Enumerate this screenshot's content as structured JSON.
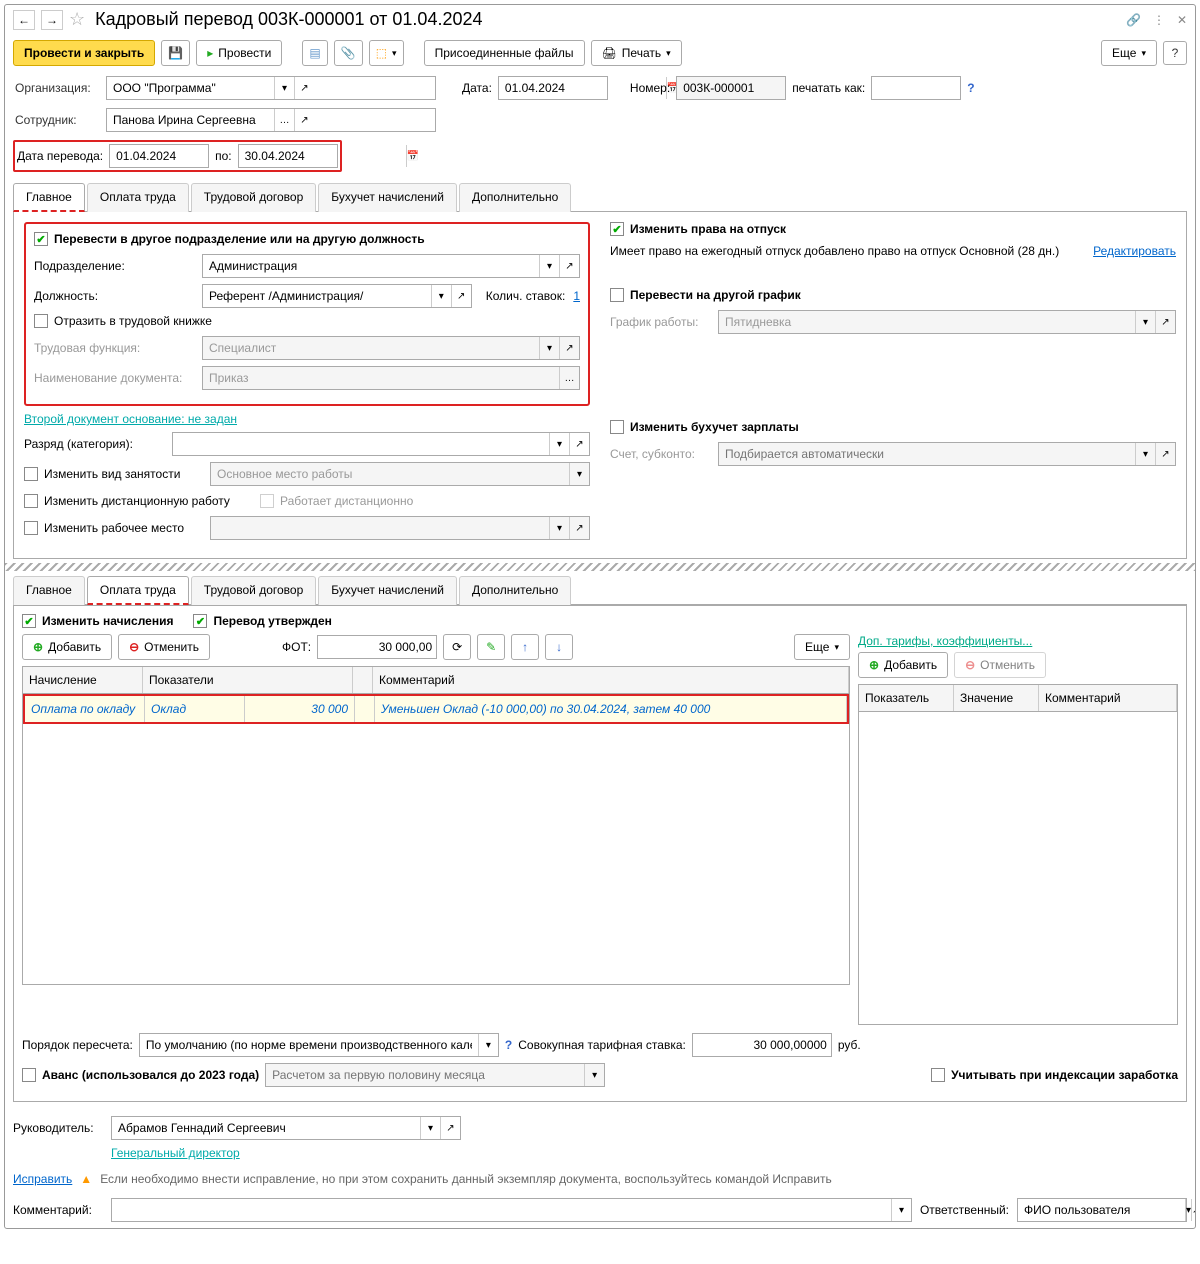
{
  "title": "Кадровый перевод 003К-000001 от 01.04.2024",
  "toolbar": {
    "post_close": "Провести и закрыть",
    "post": "Провести",
    "attached": "Присоединенные файлы",
    "print": "Печать",
    "more": "Еще"
  },
  "header": {
    "org_label": "Организация:",
    "org_value": "ООО \"Программа\"",
    "date_label": "Дата:",
    "date_value": "01.04.2024",
    "num_label": "Номер:",
    "num_value": "003К-000001",
    "print_as_label": "печатать как:",
    "emp_label": "Сотрудник:",
    "emp_value": "Панова Ирина Сергеевна",
    "transfer_date_label": "Дата перевода:",
    "transfer_from": "01.04.2024",
    "to_label": "по:",
    "transfer_to": "30.04.2024"
  },
  "tabs1": [
    "Главное",
    "Оплата труда",
    "Трудовой договор",
    "Бухучет начислений",
    "Дополнительно"
  ],
  "main": {
    "transfer_chk": "Перевести в другое подразделение или на другую должность",
    "subdiv_label": "Подразделение:",
    "subdiv_value": "Администрация",
    "pos_label": "Должность:",
    "pos_value": "Референт /Администрация/",
    "rates_label": "Колич. ставок:",
    "rates_value": "1",
    "labor_book": "Отразить в трудовой книжке",
    "func_label": "Трудовая функция:",
    "func_value": "Специалист",
    "docname_label": "Наименование документа:",
    "docname_value": "Приказ",
    "second_doc": "Второй документ основание: не задан",
    "grade_label": "Разряд (категория):",
    "change_emp": "Изменить вид занятости",
    "emp_type": "Основное место работы",
    "change_remote": "Изменить дистанционную работу",
    "remote_val": "Работает дистанционно",
    "change_workplace": "Изменить рабочее место",
    "vac_chk": "Изменить права на отпуск",
    "vac_text": "Имеет право на ежегодный отпуск добавлено право на отпуск Основной (28 дн.)",
    "edit_link": "Редактировать",
    "sched_chk": "Перевести на другой график",
    "sched_label": "График работы:",
    "sched_value": "Пятидневка",
    "change_acc": "Изменить бухучет зарплаты",
    "acc_label": "Счет, субконто:",
    "acc_ph": "Подбирается автоматически"
  },
  "pay": {
    "change_accruals": "Изменить начисления",
    "transfer_approved": "Перевод утвержден",
    "add": "Добавить",
    "cancel": "Отменить",
    "fot_label": "ФОТ:",
    "fot_value": "30 000,00",
    "more": "Еще",
    "cols": {
      "c1": "Начисление",
      "c2": "Показатели",
      "c3": "Комментарий"
    },
    "row": {
      "c1": "Оплата по окладу",
      "c2a": "Оклад",
      "c2b": "30 000",
      "c3": "Уменьшен Оклад (-10 000,00) по 30.04.2024, затем 40 000"
    },
    "extra_title": "Доп. тарифы, коэффициенты...",
    "extra_cols": {
      "c1": "Показатель",
      "c2": "Значение",
      "c3": "Комментарий"
    },
    "recalc_label": "Порядок пересчета:",
    "recalc_value": "По умолчанию (по норме времени производственного календаря)",
    "total_rate_label": "Совокупная тарифная ставка:",
    "total_rate_value": "30 000,00000",
    "rub": "руб.",
    "advance_chk": "Аванс (использовался до 2023 года)",
    "advance_ph": "Расчетом за первую половину месяца",
    "index_chk": "Учитывать при индексации заработка"
  },
  "footer": {
    "mgr_label": "Руководитель:",
    "mgr_value": "Абрамов Геннадий Сергеевич",
    "mgr_pos": "Генеральный директор",
    "fix_link": "Исправить",
    "fix_text": "Если необходимо внести исправление, но при этом сохранить данный экземпляр документа, воспользуйтесь командой Исправить",
    "comment_label": "Комментарий:",
    "resp_label": "Ответственный:",
    "resp_value": "ФИО пользователя"
  }
}
